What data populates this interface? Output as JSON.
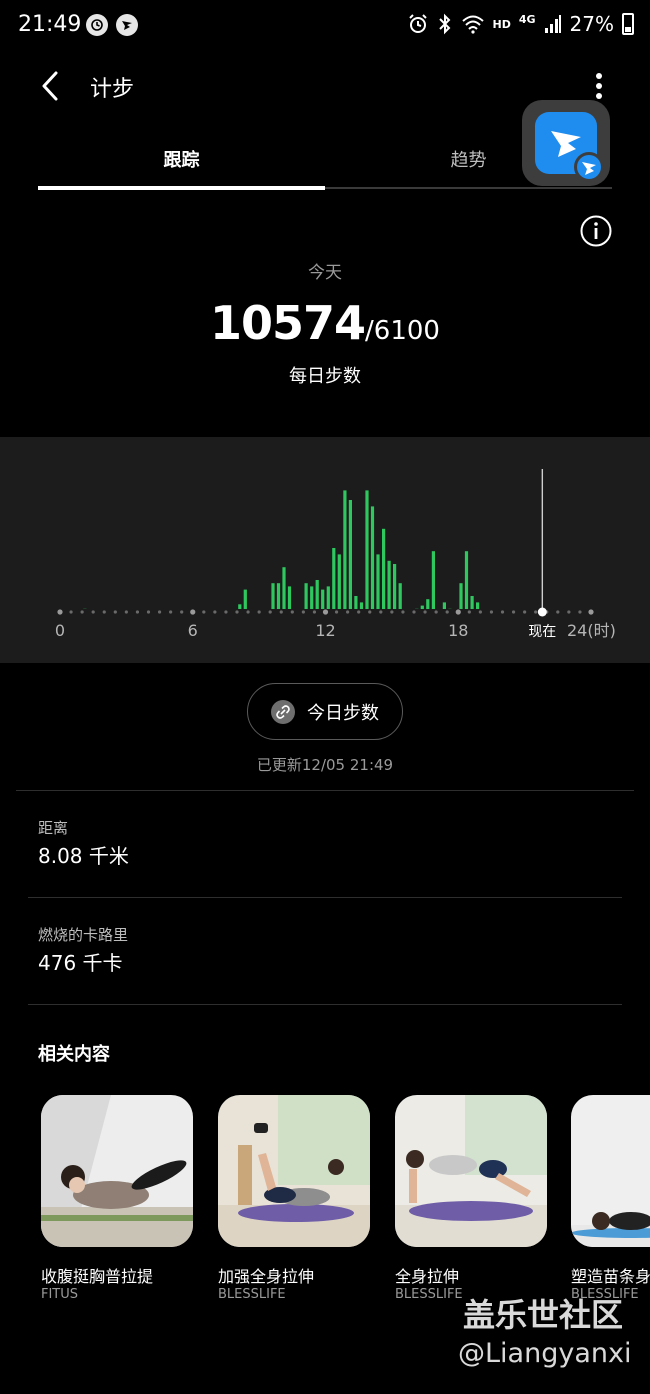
{
  "status_bar": {
    "time": "21:49",
    "network": "HD",
    "signal_label": "4G",
    "battery": "27%"
  },
  "app_bar": {
    "title": "计步"
  },
  "tabs": [
    {
      "label": "跟踪",
      "active": true
    },
    {
      "label": "趋势",
      "active": false
    }
  ],
  "summary": {
    "today_label": "今天",
    "steps": "10574",
    "target": "/6100",
    "caption": "每日步数"
  },
  "chart_data": {
    "type": "bar",
    "series": [
      {
        "values": [
          0,
          0,
          0,
          0,
          5,
          0,
          0,
          0,
          0,
          0,
          0,
          0,
          0,
          0,
          0,
          0,
          0,
          0,
          0,
          0,
          0,
          0,
          0,
          0,
          0,
          0,
          0,
          0,
          0,
          0,
          0,
          0,
          12,
          35,
          0,
          0,
          0,
          0,
          45,
          45,
          70,
          40,
          0,
          0,
          45,
          40,
          50,
          35,
          40,
          100,
          90,
          190,
          175,
          25,
          15,
          190,
          165,
          90,
          130,
          80,
          75,
          45,
          0,
          0,
          5,
          10,
          20,
          95,
          0,
          15,
          5,
          0,
          45,
          95,
          25,
          15,
          0,
          0,
          0,
          0,
          0,
          0,
          0,
          0,
          0,
          0,
          0,
          0,
          0,
          0,
          0,
          0,
          0,
          0,
          0,
          0
        ]
      }
    ],
    "xlim": [
      0,
      24
    ],
    "ylim": [
      0,
      200
    ],
    "xticks": [
      "0",
      "6",
      "12",
      "18",
      "现在",
      "24(时)"
    ],
    "now_marker": 21.8,
    "bar_color": "#2ec85f"
  },
  "share_button": {
    "label": "今日步数"
  },
  "updated": "已更新12/05 21:49",
  "stats": [
    {
      "label": "距离",
      "value": "8.08 千米"
    },
    {
      "label": "燃烧的卡路里",
      "value": "476 千卡"
    }
  ],
  "related": {
    "title": "相关内容",
    "items": [
      {
        "title": "收腹挺胸普拉提",
        "source": "FITUS"
      },
      {
        "title": "加强全身拉伸",
        "source": "BLESSLIFE"
      },
      {
        "title": "全身拉伸",
        "source": "BLESSLIFE"
      },
      {
        "title": "塑造苗条身",
        "source": "BLESSLIFE"
      }
    ]
  },
  "watermark": {
    "line1": "盖乐世社区",
    "line2": "@Liangyanxi"
  }
}
